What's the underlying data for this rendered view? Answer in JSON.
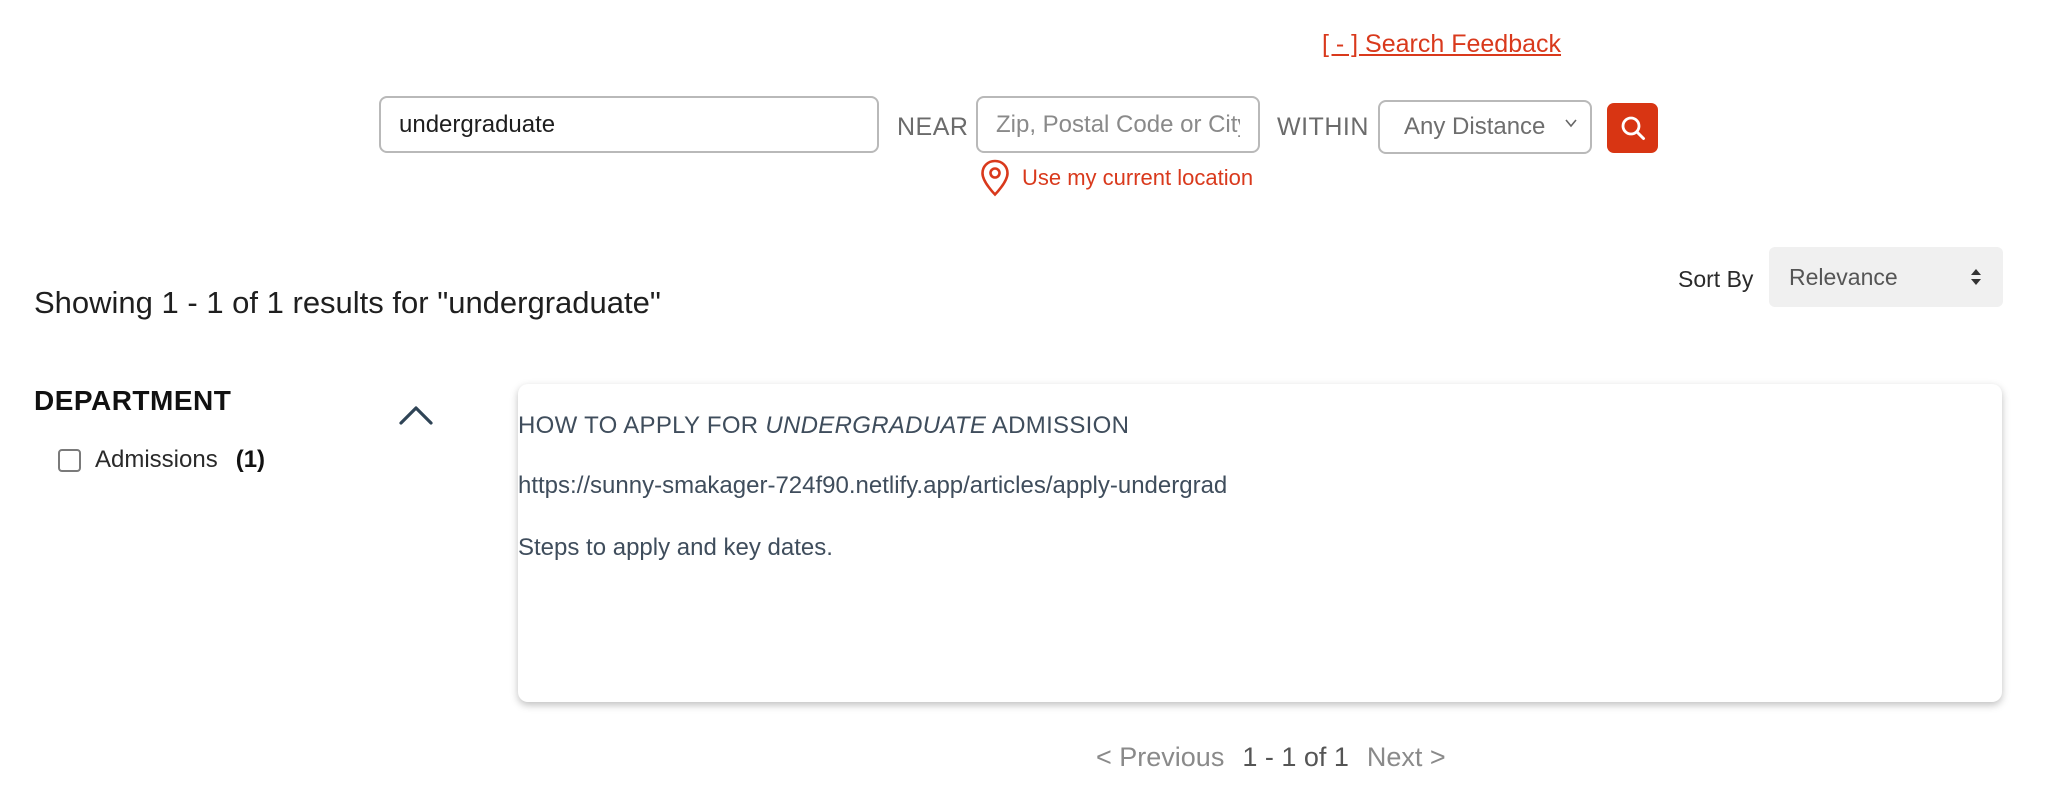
{
  "feedback": {
    "label": "[ - ] Search Feedback"
  },
  "search": {
    "query_value": "undergraduate",
    "near_label": "NEAR",
    "location_placeholder": "Zip, Postal Code or City",
    "within_label": "WITHIN",
    "distance_selected": "Any Distance",
    "use_location_label": "Use my current location"
  },
  "results": {
    "summary": "Showing 1 - 1 of 1 results for \"undergraduate\"",
    "sort_label": "Sort By",
    "sort_selected": "Relevance",
    "items": [
      {
        "title_prefix": "HOW TO APPLY FOR ",
        "title_highlight": "UNDERGRADUATE",
        "title_suffix": " ADMISSION",
        "url": "https://sunny-smakager-724f90.netlify.app/articles/apply-undergrad",
        "description": "Steps to apply and key dates."
      }
    ]
  },
  "facets": {
    "department": {
      "title": "DEPARTMENT",
      "options": [
        {
          "label": "Admissions",
          "count": "(1)"
        }
      ]
    }
  },
  "pagination": {
    "previous": "< Previous",
    "range": "1 - 1 of 1",
    "next": "Next >"
  },
  "colors": {
    "accent": "#d83513",
    "link": "#d9391c",
    "result_text": "#3f4d5c"
  }
}
